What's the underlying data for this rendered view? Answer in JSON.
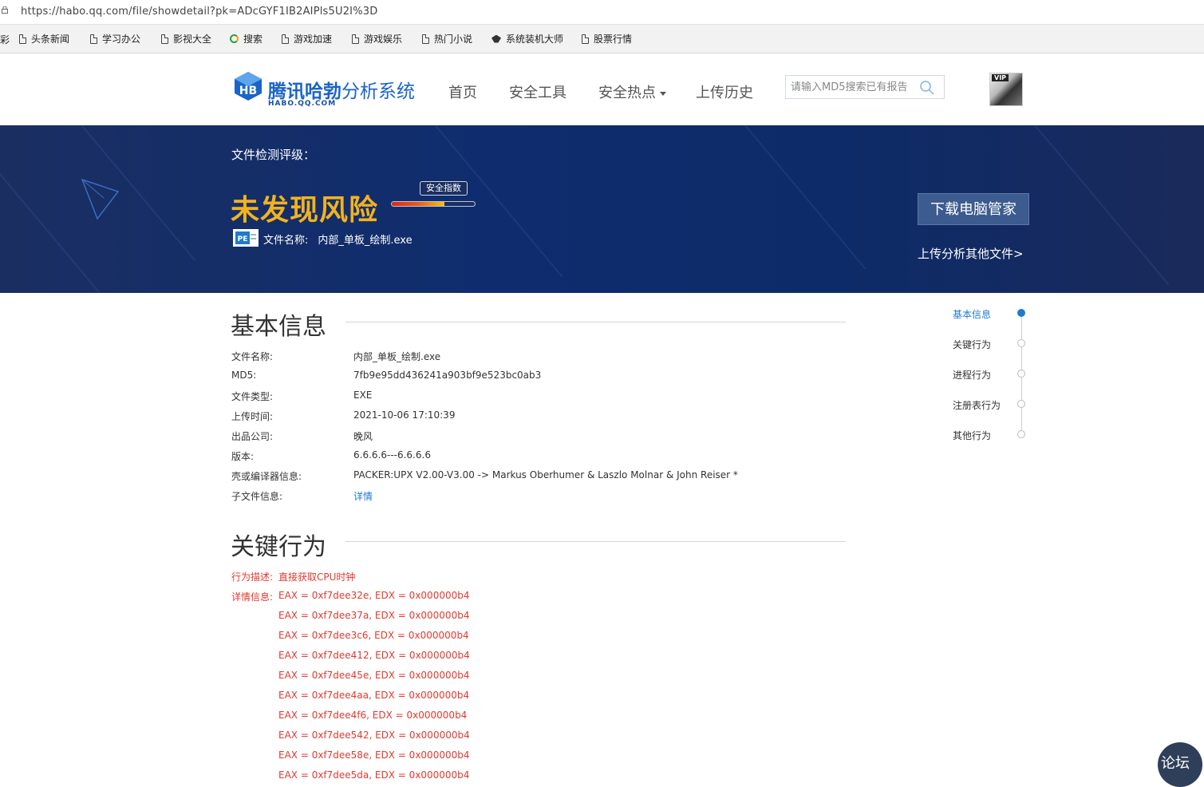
{
  "browser": {
    "url": "https://habo.qq.com/file/showdetail?pk=ADcGYF1IB2AIPls5U2I%3D",
    "bookmarks_edge_text": "彩",
    "bookmarks": [
      "头条新闻",
      "学习办公",
      "影视大全",
      "搜索",
      "游戏加速",
      "游戏娱乐",
      "热门小说",
      "系统装机大师",
      "股票行情"
    ]
  },
  "header": {
    "logo_bold": "腾讯哈勃",
    "logo_light": "分析系统",
    "logo_sub": "HABO.QQ.COM",
    "nav": [
      "首页",
      "安全工具",
      "安全热点",
      "上传历史"
    ],
    "search_placeholder": "请输入MD5搜索已有报告",
    "avatar_badge": "VIP"
  },
  "banner": {
    "label": "文件检测评级：",
    "result": "未发现风险",
    "gauge_label": "安全指数",
    "gauge_level": 0.63,
    "file_icon_text": "PE",
    "file_name_label": "文件名称:",
    "file_name": "内部_单板_绘制.exe",
    "download_button": "下载电脑管家",
    "upload_link": "上传分析其他文件>"
  },
  "basic": {
    "title": "基本信息",
    "rows": [
      {
        "k": "文件名称:",
        "v": "内部_单板_绘制.exe"
      },
      {
        "k": "MD5:",
        "v": "7fb9e95dd436241a903bf9e523bc0ab3"
      },
      {
        "k": "文件类型:",
        "v": "EXE"
      },
      {
        "k": "上传时间:",
        "v": "2021-10-06 17:10:39"
      },
      {
        "k": "出品公司:",
        "v": "晚风"
      },
      {
        "k": "版本:",
        "v": "6.6.6.6---6.6.6.6"
      },
      {
        "k": "壳或编译器信息:",
        "v": "PACKER:UPX V2.00-V3.00 -> Markus Oberhumer & Laszlo Molnar & John Reiser *"
      },
      {
        "k": "子文件信息:",
        "v": "详情"
      }
    ]
  },
  "behavior": {
    "title": "关键行为",
    "desc_label": "行为描述:",
    "desc": "直接获取CPU时钟",
    "detail_label": "详情信息:",
    "details": [
      "EAX = 0xf7dee32e, EDX = 0x000000b4",
      "EAX = 0xf7dee37a, EDX = 0x000000b4",
      "EAX = 0xf7dee3c6, EDX = 0x000000b4",
      "EAX = 0xf7dee412, EDX = 0x000000b4",
      "EAX = 0xf7dee45e, EDX = 0x000000b4",
      "EAX = 0xf7dee4aa, EDX = 0x000000b4",
      "EAX = 0xf7dee4f6, EDX = 0x000000b4",
      "EAX = 0xf7dee542, EDX = 0x000000b4",
      "EAX = 0xf7dee58e, EDX = 0x000000b4",
      "EAX = 0xf7dee5da, EDX = 0x000000b4"
    ]
  },
  "sidenav": {
    "items": [
      "基本信息",
      "关键行为",
      "进程行为",
      "注册表行为",
      "其他行为"
    ],
    "active": "基本信息"
  },
  "watermark": {
    "text": "论坛"
  },
  "colors": {
    "accent": "#1f7ad0",
    "result": "#f2b21e",
    "behavior_text": "#e03a2f",
    "banner": "#0f2d6e"
  }
}
